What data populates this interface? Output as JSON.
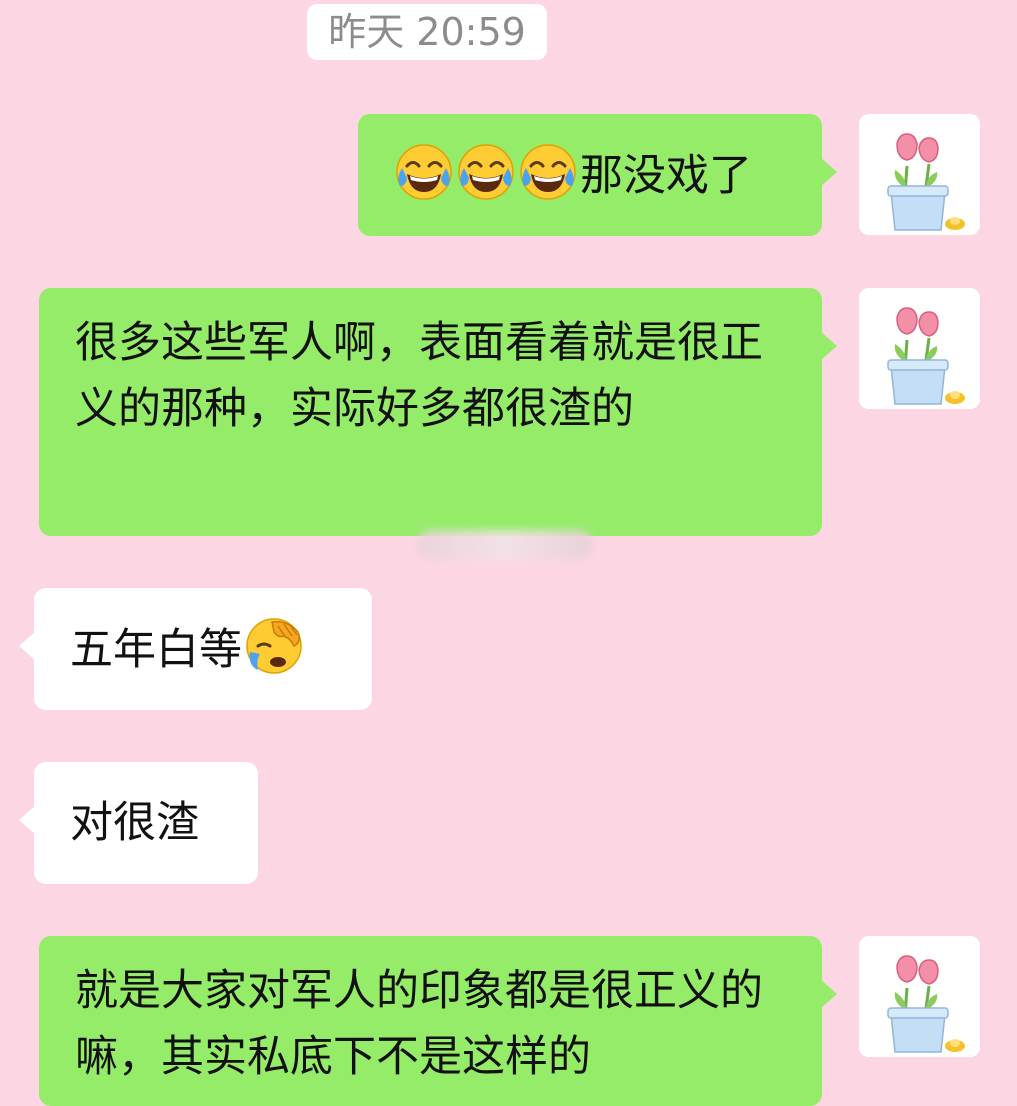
{
  "chat": {
    "timestamp": "昨天 20:59",
    "messages": [
      {
        "side": "out",
        "text": "那没戏了",
        "emoji_prefix": [
          "tears-of-joy",
          "tears-of-joy",
          "tears-of-joy"
        ]
      },
      {
        "side": "out",
        "text": "很多这些军人啊，表面看着就是很正义的那种，实际好多都很渣的"
      },
      {
        "side": "in",
        "text": "五年白等",
        "emoji_suffix": "face-palm"
      },
      {
        "side": "in",
        "text": "对很渣"
      },
      {
        "side": "out",
        "text": "就是大家对军人的印象都是很正义的嘛，其实私底下不是这样的"
      }
    ]
  },
  "colors": {
    "background": "#fcd6e3",
    "outgoing_bubble": "#95ec69",
    "incoming_bubble": "#ffffff",
    "timestamp_text": "#8c8c8c"
  },
  "icons": {
    "avatar": "tulip-pot-avatar",
    "emoji_1": "tears-of-joy-emoji",
    "emoji_2": "face-palm-emoji"
  }
}
